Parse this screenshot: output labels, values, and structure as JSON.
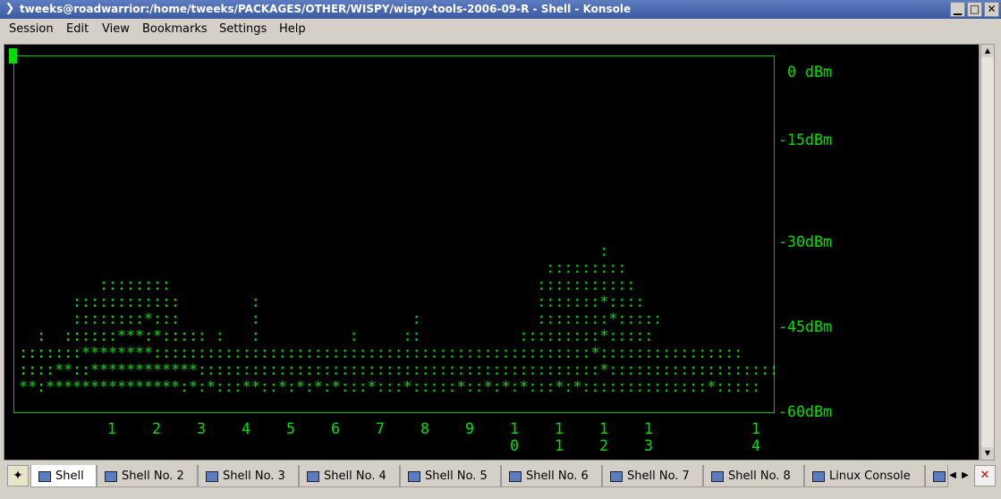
{
  "window": {
    "title": "tweeks@roadwarrior:/home/tweeks/PACKAGES/OTHER/WISPY/wispy-tools-2006-09-R - Shell - Konsole",
    "menu_glyph": "❯",
    "buttons": {
      "minimize": "▁",
      "maximize": "□",
      "close": "✕"
    }
  },
  "menubar": [
    "Session",
    "Edit",
    "View",
    "Bookmarks",
    "Settings",
    "Help"
  ],
  "terminal": {
    "y_labels": [
      "0 dBm",
      "-15dBm",
      "-30dBm",
      "-45dBm",
      "-60dBm"
    ],
    "x_labels": [
      {
        "top": "1",
        "bottom": ""
      },
      {
        "top": "2",
        "bottom": ""
      },
      {
        "top": "3",
        "bottom": ""
      },
      {
        "top": "4",
        "bottom": ""
      },
      {
        "top": "5",
        "bottom": ""
      },
      {
        "top": "6",
        "bottom": ""
      },
      {
        "top": "7",
        "bottom": ""
      },
      {
        "top": "8",
        "bottom": ""
      },
      {
        "top": "9",
        "bottom": ""
      },
      {
        "top": "1",
        "bottom": "0"
      },
      {
        "top": "1",
        "bottom": "1"
      },
      {
        "top": "1",
        "bottom": "2"
      },
      {
        "top": "1",
        "bottom": "3"
      },
      {
        "top": "1",
        "bottom": "4"
      }
    ],
    "spectrum_lines": [
      "                                                                 :",
      "                                                           :::::::::",
      "         ::::::::                                         :::::::::::",
      "      ::::::::::::        :                               :::::::*::::",
      "      ::::::::*:::        :                 :             ::::::::*:::::",
      "  :  ::::::***:*::::: :   :          :     ::           :::::::::*:::::",
      ":::::::********:::::::::::::::::::::::::::::::::::::::::::::::::*::::::::::::::::",
      "::::**::************:::::::::::::::::::::::::::::::::::::::::::::*:::::::::::::::::::",
      "**:***************:*:*:::**::*:*:*:*:::*:::*:::::*::*:*:*:::*:*::::::::::::::*:::::"
    ]
  },
  "tabs": [
    "Shell",
    "Shell No. 2",
    "Shell No. 3",
    "Shell No. 4",
    "Shell No. 5",
    "Shell No. 6",
    "Shell No. 7",
    "Shell No. 8",
    "Linux Console"
  ],
  "icons": {
    "new_tab": "✦",
    "prev": "◀",
    "next": "▶",
    "close_tab": "✕",
    "scroll_up": "▲",
    "scroll_down": "▼"
  }
}
